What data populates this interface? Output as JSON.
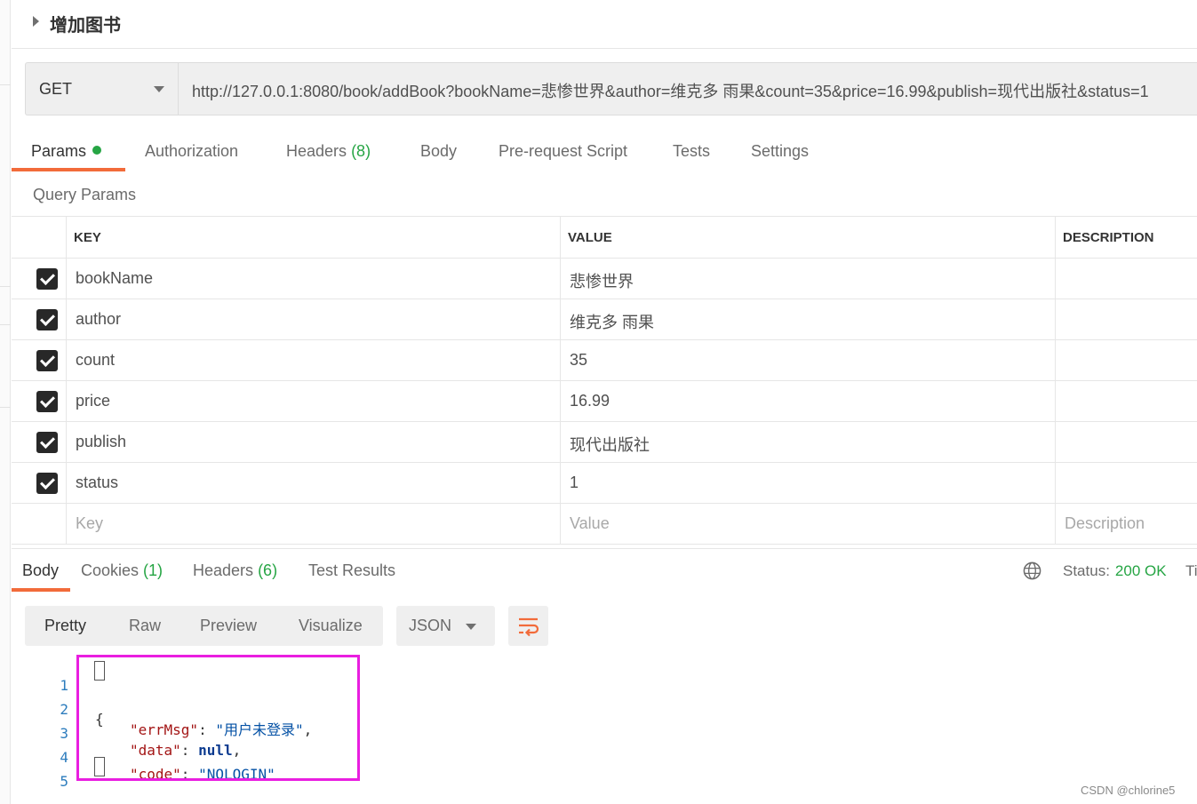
{
  "header": {
    "title": "增加图书"
  },
  "request": {
    "method": "GET",
    "url": "http://127.0.0.1:8080/book/addBook?bookName=悲惨世界&author=维克多 雨果&count=35&price=16.99&publish=现代出版社&status=1"
  },
  "request_tabs": [
    {
      "label": "Params",
      "count": "",
      "active": true,
      "dot": true
    },
    {
      "label": "Authorization",
      "count": ""
    },
    {
      "label": "Headers",
      "count": "(8)"
    },
    {
      "label": "Body",
      "count": ""
    },
    {
      "label": "Pre-request Script",
      "count": ""
    },
    {
      "label": "Tests",
      "count": ""
    },
    {
      "label": "Settings",
      "count": ""
    }
  ],
  "query_params": {
    "label": "Query Params",
    "headers": {
      "key": "KEY",
      "value": "VALUE",
      "description": "DESCRIPTION"
    },
    "rows": [
      {
        "key": "bookName",
        "value": "悲惨世界",
        "checked": true
      },
      {
        "key": "author",
        "value": "维克多 雨果",
        "checked": true
      },
      {
        "key": "count",
        "value": "35",
        "checked": true
      },
      {
        "key": "price",
        "value": "16.99",
        "checked": true
      },
      {
        "key": "publish",
        "value": "现代出版社",
        "checked": true
      },
      {
        "key": "status",
        "value": "1",
        "checked": true
      }
    ],
    "placeholders": {
      "key": "Key",
      "value": "Value",
      "description": "Description"
    }
  },
  "response_tabs": [
    {
      "label": "Body",
      "count": "",
      "active": true
    },
    {
      "label": "Cookies",
      "count": "(1)"
    },
    {
      "label": "Headers",
      "count": "(6)"
    },
    {
      "label": "Test Results",
      "count": ""
    }
  ],
  "response_status": {
    "label": "Status:",
    "value": "200 OK",
    "truncated": "Ti"
  },
  "view_modes": [
    "Pretty",
    "Raw",
    "Preview",
    "Visualize"
  ],
  "format": "JSON",
  "code_lines": [
    {
      "num": "1",
      "text": "{"
    },
    {
      "num": "2",
      "key": "\"errMsg\"",
      "sep": ": ",
      "val": "\"用户未登录\"",
      "end": ","
    },
    {
      "num": "3",
      "key": "\"data\"",
      "sep": ": ",
      "val": "null",
      "end": ","
    },
    {
      "num": "4",
      "key": "\"code\"",
      "sep": ": ",
      "val": "\"NOLOGIN\"",
      "end": ""
    },
    {
      "num": "5",
      "text": "}"
    }
  ],
  "watermark": "CSDN @chlorine5",
  "colors": {
    "accent": "#f26b3a",
    "green": "#26a544",
    "highlight": "#e91ee0"
  }
}
